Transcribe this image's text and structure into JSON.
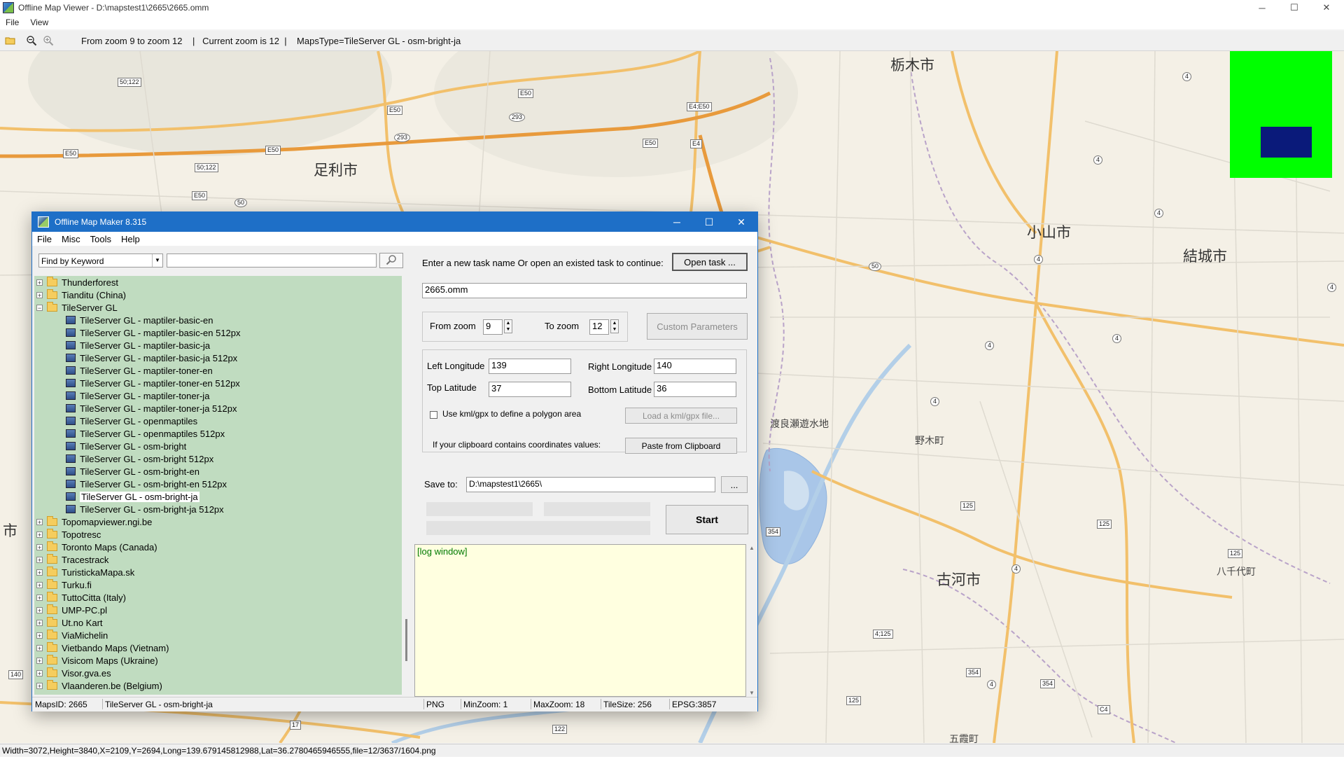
{
  "window": {
    "title": "Offline Map Viewer - D:\\mapstest1\\2665\\2665.omm",
    "menu": [
      "File",
      "View"
    ],
    "toolbar_info": "From zoom 9 to zoom 12    |   Current zoom is 12  |    MapsType=TileServer GL - osm-bright-ja",
    "controls": {
      "minimize": "─",
      "maximize": "☐",
      "close": "✕"
    }
  },
  "map": {
    "cities": [
      {
        "name": "栃木市"
      },
      {
        "name": "足利市"
      },
      {
        "name": "小山市"
      },
      {
        "name": "結城市"
      },
      {
        "name": "古河市"
      },
      {
        "name": "市"
      }
    ],
    "towns": [
      {
        "name": "渡良瀬遊水地"
      },
      {
        "name": "野木町"
      },
      {
        "name": "八千代町"
      },
      {
        "name": "五霞町"
      }
    ],
    "shields": [
      "50;122",
      "E50",
      "E50",
      "293",
      "293",
      "E50",
      "50;122",
      "E50",
      "50",
      "E50",
      "E4;E50",
      "E50",
      "E4",
      "4",
      "4",
      "4",
      "4",
      "4",
      "50",
      "4",
      "4",
      "4",
      "125",
      "125",
      "354",
      "4",
      "125",
      "4;125",
      "354",
      "4",
      "354",
      "125",
      "C4",
      "140",
      "17",
      "122"
    ]
  },
  "minimap": {
    "bg_color": "#00ff00",
    "view_color": "#0a1a7a"
  },
  "status_bar": "Width=3072,Height=3840,X=2109,Y=2694,Long=139.679145812988,Lat=36.2780465946555,file=12/3637/1604.png",
  "dialog": {
    "title": "Offline Map Maker 8.315",
    "menu": [
      "File",
      "Misc",
      "Tools",
      "Help"
    ],
    "controls": {
      "minimize": "─",
      "maximize": "☐",
      "close": "✕"
    },
    "search": {
      "mode": "Find by Keyword",
      "keyword": ""
    },
    "tree": [
      {
        "label": "Thunderforest",
        "type": "folder",
        "expanded": false
      },
      {
        "label": "Tianditu (China)",
        "type": "folder",
        "expanded": false
      },
      {
        "label": "TileServer GL",
        "type": "folder",
        "expanded": true
      },
      {
        "label": "TileServer GL - maptiler-basic-en",
        "type": "map"
      },
      {
        "label": "TileServer GL - maptiler-basic-en 512px",
        "type": "map"
      },
      {
        "label": "TileServer GL - maptiler-basic-ja",
        "type": "map"
      },
      {
        "label": "TileServer GL - maptiler-basic-ja 512px",
        "type": "map"
      },
      {
        "label": "TileServer GL - maptiler-toner-en",
        "type": "map"
      },
      {
        "label": "TileServer GL - maptiler-toner-en 512px",
        "type": "map"
      },
      {
        "label": "TileServer GL - maptiler-toner-ja",
        "type": "map"
      },
      {
        "label": "TileServer GL - maptiler-toner-ja 512px",
        "type": "map"
      },
      {
        "label": "TileServer GL - openmaptiles",
        "type": "map"
      },
      {
        "label": "TileServer GL - openmaptiles 512px",
        "type": "map"
      },
      {
        "label": "TileServer GL - osm-bright",
        "type": "map"
      },
      {
        "label": "TileServer GL - osm-bright 512px",
        "type": "map"
      },
      {
        "label": "TileServer GL - osm-bright-en",
        "type": "map"
      },
      {
        "label": "TileServer GL - osm-bright-en 512px",
        "type": "map"
      },
      {
        "label": "TileServer GL - osm-bright-ja",
        "type": "map",
        "selected": true
      },
      {
        "label": "TileServer GL - osm-bright-ja 512px",
        "type": "map"
      },
      {
        "label": "Topomapviewer.ngi.be",
        "type": "folder",
        "expanded": false
      },
      {
        "label": "Topotresc",
        "type": "folder",
        "expanded": false
      },
      {
        "label": "Toronto Maps (Canada)",
        "type": "folder",
        "expanded": false
      },
      {
        "label": "Tracestrack",
        "type": "folder",
        "expanded": false
      },
      {
        "label": "TuristickaMapa.sk",
        "type": "folder",
        "expanded": false
      },
      {
        "label": "Turku.fi",
        "type": "folder",
        "expanded": false
      },
      {
        "label": "TuttoCitta (Italy)",
        "type": "folder",
        "expanded": false
      },
      {
        "label": "UMP-PC.pl",
        "type": "folder",
        "expanded": false
      },
      {
        "label": "Ut.no Kart",
        "type": "folder",
        "expanded": false
      },
      {
        "label": "ViaMichelin",
        "type": "folder",
        "expanded": false
      },
      {
        "label": "Vietbando Maps (Vietnam)",
        "type": "folder",
        "expanded": false
      },
      {
        "label": "Visicom Maps (Ukraine)",
        "type": "folder",
        "expanded": false
      },
      {
        "label": "Visor.gva.es",
        "type": "folder",
        "expanded": false
      },
      {
        "label": "Vlaanderen.be (Belgium)",
        "type": "folder",
        "expanded": false
      }
    ],
    "task": {
      "prompt": "Enter a new task name Or open an existed task to continue:",
      "open_button": "Open task ...",
      "name": "2665.omm"
    },
    "zoom": {
      "from_label": "From zoom",
      "from_value": "9",
      "to_label": "To zoom",
      "to_value": "12",
      "custom_button": "Custom Parameters"
    },
    "bounds": {
      "left_label": "Left Longitude",
      "left_value": "139",
      "right_label": "Right Longitude",
      "right_value": "140",
      "top_label": "Top Latitude",
      "top_value": "37",
      "bottom_label": "Bottom Latitude",
      "bottom_value": "36",
      "polygon_label": "Use kml/gpx to define a polygon area",
      "polygon_checked": false,
      "load_button": "Load a kml/gpx file...",
      "clipboard_label": "If your clipboard contains coordinates values:",
      "clipboard_button": "Paste from Clipboard"
    },
    "save": {
      "label": "Save to:",
      "path": "D:\\mapstest1\\2665\\",
      "browse_button": "..."
    },
    "start_button": "Start",
    "log": "[log window]",
    "status": {
      "maps_id": "MapsID: 2665",
      "map_name": "TileServer GL - osm-bright-ja",
      "format": "PNG",
      "min_zoom": "MinZoom: 1",
      "max_zoom": "MaxZoom: 18",
      "tile_size": "TileSize: 256",
      "epsg": "EPSG:3857"
    }
  }
}
